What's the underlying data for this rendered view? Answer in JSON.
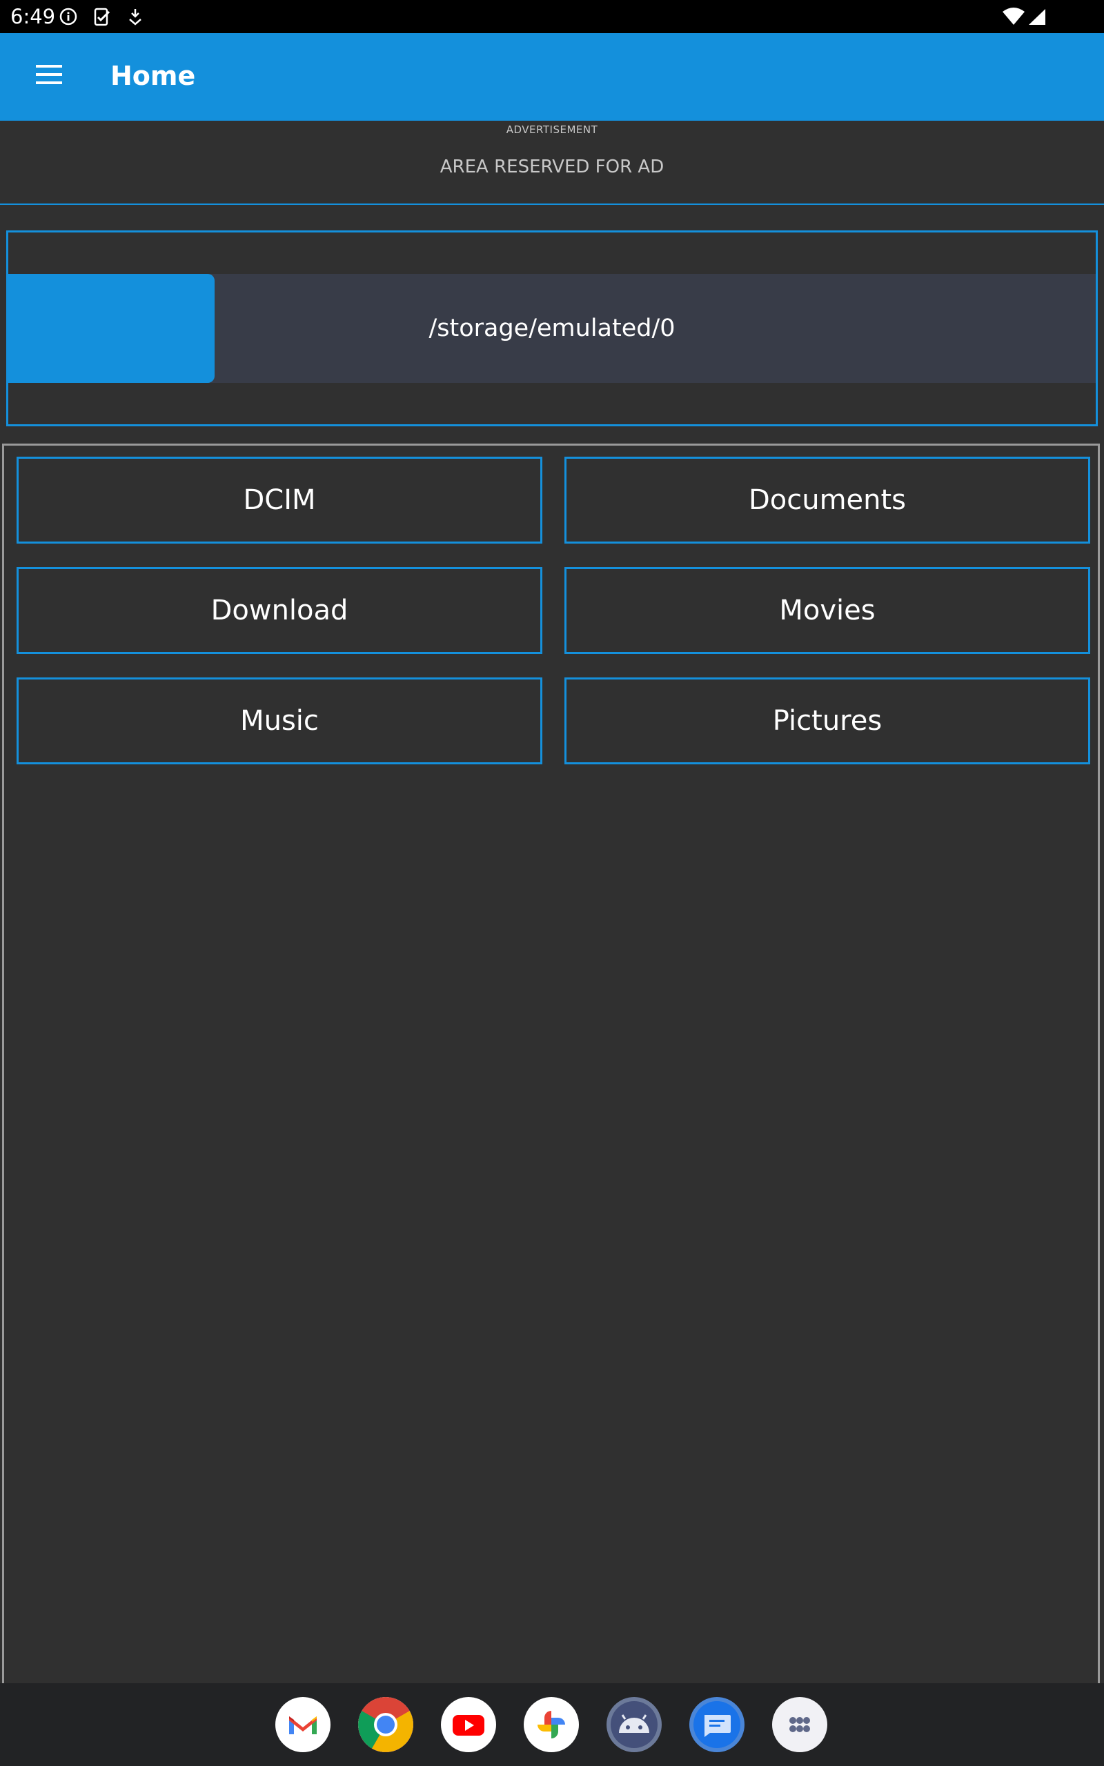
{
  "status_bar": {
    "time": "6:49",
    "left_icons": [
      "info-icon",
      "device-check-icon",
      "download-tray-icon"
    ],
    "right_icons": [
      "wifi-icon",
      "cell-signal-icon"
    ]
  },
  "app_bar": {
    "title": "Home",
    "menu_icon": "hamburger-menu-icon",
    "color": "#1490dc"
  },
  "ad": {
    "small_label": "ADVERTISEMENT",
    "main_label": "AREA RESERVED FOR AD"
  },
  "storage": {
    "path": "/storage/emulated/0",
    "used_fraction": 0.19
  },
  "folders": [
    {
      "label": "DCIM"
    },
    {
      "label": "Documents"
    },
    {
      "label": "Download"
    },
    {
      "label": "Movies"
    },
    {
      "label": "Music"
    },
    {
      "label": "Pictures"
    }
  ],
  "dock": {
    "apps": [
      {
        "name": "gmail-icon"
      },
      {
        "name": "chrome-icon"
      },
      {
        "name": "youtube-icon"
      },
      {
        "name": "photos-icon"
      },
      {
        "name": "android-dev-icon"
      },
      {
        "name": "messages-icon"
      },
      {
        "name": "app-drawer-icon"
      }
    ]
  },
  "colors": {
    "accent": "#1490dc",
    "background": "#303030",
    "storage_track": "#383c48"
  }
}
